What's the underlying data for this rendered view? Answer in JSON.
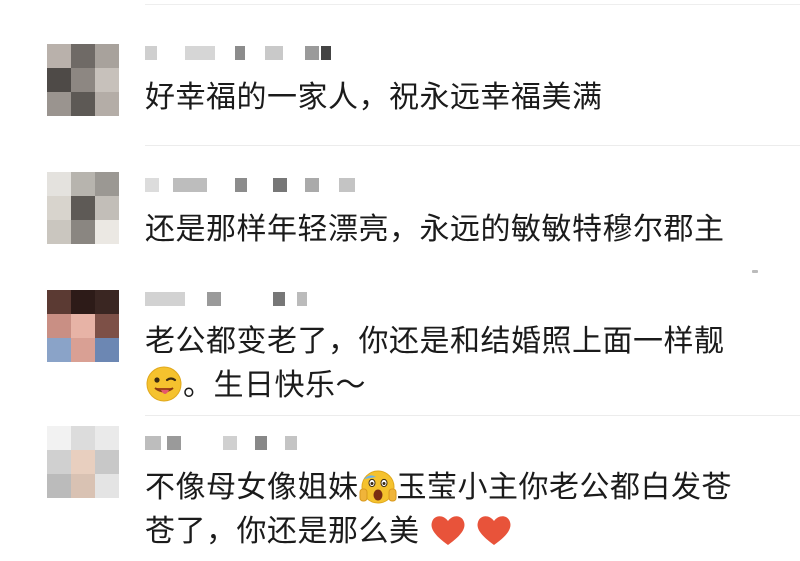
{
  "comments": [
    {
      "text": "好幸福的一家人，祝永远幸福美满"
    },
    {
      "text": "还是那样年轻漂亮，永远的敏敏特穆尔郡主"
    },
    {
      "text_line1": "老公都变老了，你还是和结婚照上面一样靓",
      "text_line2": "。生日快乐～"
    },
    {
      "text_part1": "不像母女像姐妹",
      "text_part2": "玉莹小主你老公都白发苍",
      "text_line2": "苍了，你还是那么美"
    }
  ],
  "icons": [
    "blurred-avatar",
    "blurred-username",
    "wink-tongue-emoji",
    "screaming-face-emoji",
    "red-heart-emoji"
  ],
  "colors": {
    "text": "#1b1b1b",
    "heart": "#e8533a",
    "emoji_yellow": "#f5c22e"
  }
}
